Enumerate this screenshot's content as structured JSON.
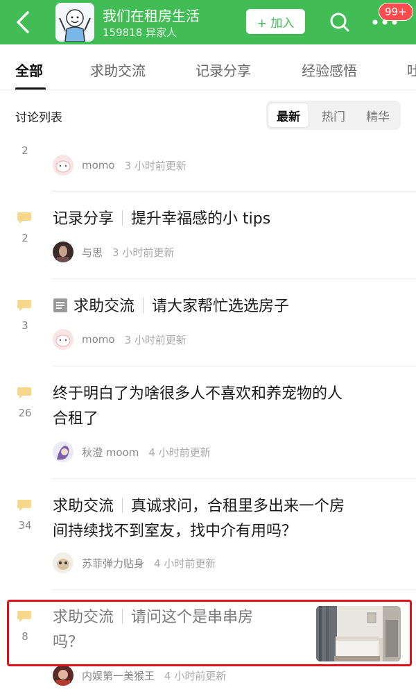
{
  "header": {
    "title": "我们在租房生活",
    "subtitle": "159818 异家人",
    "join_label": "+ 加入",
    "badge": "99+"
  },
  "colors": {
    "brand": "#42bd56",
    "badge": "#ff4d4f",
    "highlight": "#e0101a",
    "comment_icon": "#f7d78c"
  },
  "tabs": [
    {
      "label": "全部",
      "active": true
    },
    {
      "label": "求助交流"
    },
    {
      "label": "记录分享"
    },
    {
      "label": "经验感悟"
    },
    {
      "label": "吐"
    }
  ],
  "list_header": {
    "title": "讨论列表",
    "sort": [
      "最新",
      "热门",
      "精华"
    ],
    "sort_active": "最新"
  },
  "posts": [
    {
      "count": "2",
      "author": "momo",
      "time": "3 小时前更新"
    },
    {
      "count": "2",
      "tag": "记录分享",
      "title": "提升幸福感的小 tips",
      "author": "与思",
      "time": "3 小时前更新"
    },
    {
      "count": "3",
      "tag": "求助交流",
      "title": "请大家帮忙选选房子",
      "author": "momo",
      "time": "3 小时前更新",
      "icon": "document-icon"
    },
    {
      "count": "26",
      "title_line1": "终于明白了为啥很多人不喜欢和养宠物的人",
      "title_line2": "合租了",
      "author": "秋澄 moom",
      "time": "4 小时前更新"
    },
    {
      "count": "34",
      "tag": "求助交流",
      "title_line1": "真诚求问，合租里多出来一个房",
      "title_line2": "间持续找不到室友，找中介有用吗？",
      "author": "苏菲弹力贴身",
      "time": "4 小时前更新"
    },
    {
      "count": "8",
      "tag": "求助交流",
      "title_line1": "请问这个是串串房",
      "title_line2": "吗？",
      "author": "内娱第一美猴王",
      "time": "4 小时前更新",
      "has_thumbnail": true
    }
  ]
}
